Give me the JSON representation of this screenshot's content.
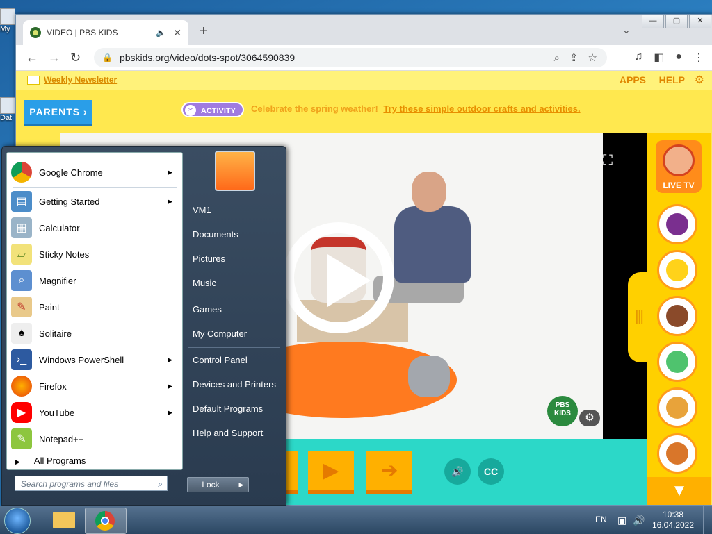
{
  "desktop": {
    "icon1_label": "My",
    "icon2_label": "Dat"
  },
  "browser": {
    "tab_title": "VIDEO | PBS KIDS",
    "url": "pbskids.org/video/dots-spot/3064590839",
    "window_buttons": [
      "—",
      "▢",
      "✕"
    ]
  },
  "page": {
    "newsletter": "Weekly Newsletter",
    "apps": "APPS",
    "help": "HELP",
    "parents": "PARENTS ›",
    "activity": "ACTIVITY",
    "promo_text": "Celebrate the spring weather!",
    "promo_link": "Try these simple outdoor crafts and activities.",
    "pbs_logo": "PBS KIDS",
    "cc": "CC",
    "live_tv": "LIVE TV"
  },
  "start_menu": {
    "items": [
      {
        "label": "Google Chrome",
        "arrow": true
      },
      {
        "label": "Getting Started",
        "arrow": true
      },
      {
        "label": "Calculator",
        "arrow": false
      },
      {
        "label": "Sticky Notes",
        "arrow": false
      },
      {
        "label": "Magnifier",
        "arrow": false
      },
      {
        "label": "Paint",
        "arrow": false
      },
      {
        "label": "Solitaire",
        "arrow": false
      },
      {
        "label": "Windows PowerShell",
        "arrow": true
      },
      {
        "label": "Firefox",
        "arrow": true
      },
      {
        "label": "YouTube",
        "arrow": true
      },
      {
        "label": "Notepad++",
        "arrow": false
      }
    ],
    "all_programs": "All Programs",
    "search_placeholder": "Search programs and files",
    "right": [
      "VM1",
      "Documents",
      "Pictures",
      "Music",
      "Games",
      "My Computer",
      "Control Panel",
      "Devices and Printers",
      "Default Programs",
      "Help and Support"
    ],
    "lock": "Lock"
  },
  "taskbar": {
    "lang": "EN",
    "time": "10:38",
    "date": "16.04.2022"
  },
  "colors": {
    "pbs_yellow": "#ffe84f",
    "teal": "#2cd8c8",
    "parents_blue": "#2a9ee8"
  }
}
